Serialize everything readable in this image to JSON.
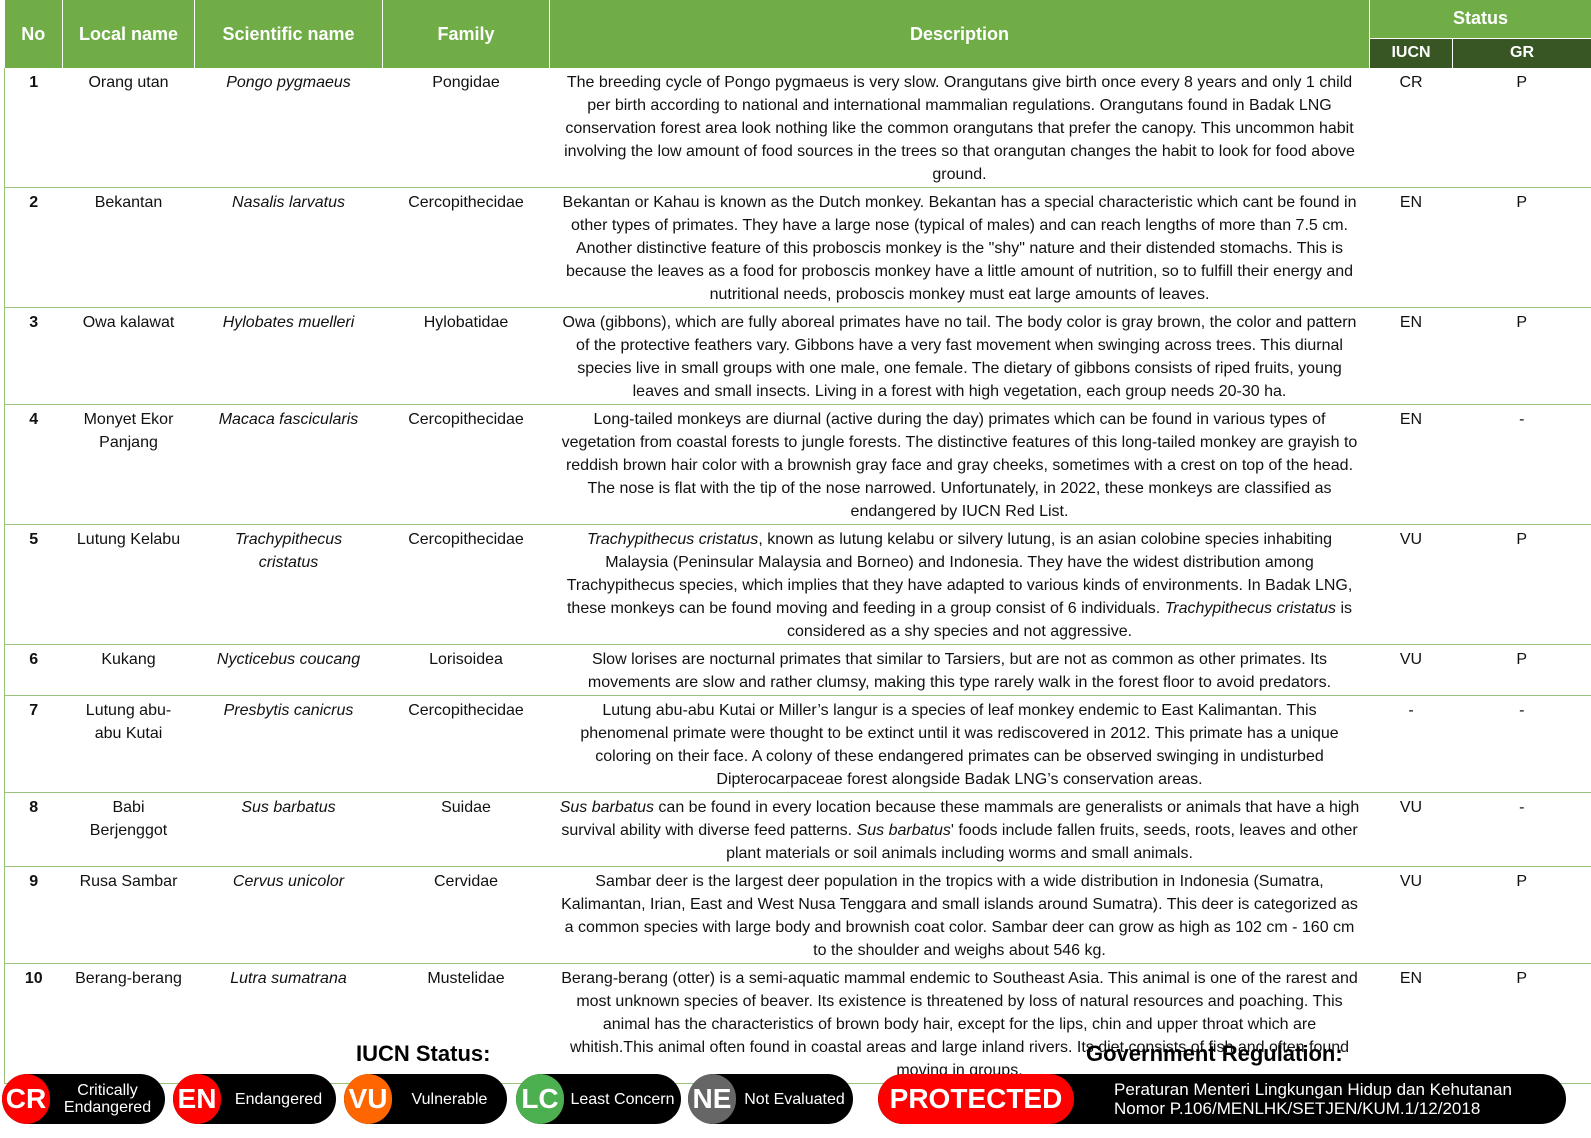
{
  "table": {
    "headers": {
      "no": "No",
      "local": "Local name",
      "scientific": "Scientific name",
      "family": "Family",
      "description": "Description",
      "status": "Status",
      "iucn": "IUCN",
      "gr": "GR"
    },
    "rows": [
      {
        "no": "1",
        "local": "Orang utan",
        "sci": "Pongo pygmaeus",
        "family": "Pongidae",
        "desc": [
          {
            "t": "The breeding cycle of Pongo pygmaeus is very slow. Orangutans give birth once every 8 years and only 1 child per birth according to national and international mammalian regulations. Orangutans found in Badak LNG conservation forest area look nothing like the common orangutans that prefer the canopy. This uncommon habit involving the low amount of food sources in the trees so that orangutan changes the habit to look for food above ground."
          }
        ],
        "iucn": "CR",
        "gr": "P"
      },
      {
        "no": "2",
        "local": "Bekantan",
        "sci": "Nasalis larvatus",
        "family": "Cercopithecidae",
        "desc": [
          {
            "t": "Bekantan or Kahau is known as the Dutch monkey. Bekantan has a special characteristic which cant be found in other types of primates. They have a large nose (typical of males) and can reach lengths of more than 7.5 cm. Another distinctive feature of this proboscis monkey is the \"shy\" nature and their distended stomachs. This is because the leaves as a food for proboscis monkey have a little amount of nutrition, so to fulfill their energy and nutritional needs, proboscis monkey must eat large amounts of leaves."
          }
        ],
        "iucn": "EN",
        "gr": "P"
      },
      {
        "no": "3",
        "local": "Owa kalawat",
        "sci": "Hylobates muelleri",
        "family": "Hylobatidae",
        "desc": [
          {
            "t": "Owa (gibbons), which are fully aboreal primates have no tail. The body color is gray brown, the color and pattern of the protective feathers vary. Gibbons have a very fast movement when swinging across trees. This diurnal species live in small groups with one male, one female. The dietary of gibbons consists of riped fruits, young leaves and small insects. Living in a forest with high vegetation, each group needs 20-30 ha."
          }
        ],
        "iucn": "EN",
        "gr": "P"
      },
      {
        "no": "4",
        "local": "Monyet Ekor Panjang",
        "sci": "Macaca fascicularis",
        "family": "Cercopithecidae",
        "desc": [
          {
            "t": "Long-tailed monkeys are diurnal (active during the day) primates which can be found in various types of vegetation from coastal forests to jungle forests. The distinctive features of this long-tailed monkey are grayish to reddish brown hair color with a brownish gray face and gray cheeks, sometimes with a crest on top of the head. The nose is flat with the tip of the nose narrowed. Unfortunately, in 2022, these monkeys are classified as endangered by IUCN Red List."
          }
        ],
        "iucn": "EN",
        "gr": "-"
      },
      {
        "no": "5",
        "local": "Lutung Kelabu",
        "sci": "Trachypithecus cristatus",
        "family": "Cercopithecidae",
        "desc": [
          {
            "t": "Trachypithecus cristatus",
            "i": true
          },
          {
            "t": ", known as lutung kelabu or silvery lutung, is an asian colobine species inhabiting Malaysia (Peninsular Malaysia and Borneo) and Indonesia. They have the widest distribution among Trachypithecus species, which implies that they have adapted to various kinds of environments. In Badak LNG, these monkeys can be found moving and feeding in a group consist of 6 individuals. "
          },
          {
            "t": "Trachypithecus cristatus",
            "i": true
          },
          {
            "t": " is considered as a shy species and not aggressive."
          }
        ],
        "iucn": "VU",
        "gr": "P"
      },
      {
        "no": "6",
        "local": "Kukang",
        "sci": "Nycticebus coucang",
        "family": "Lorisoidea",
        "desc": [
          {
            "t": "Slow lorises are nocturnal primates that similar to Tarsiers, but are not as common as other primates. Its movements are slow and rather clumsy, making this type rarely walk in the forest floor to avoid predators."
          }
        ],
        "iucn": "VU",
        "gr": "P"
      },
      {
        "no": "7",
        "local": "Lutung abu-abu Kutai",
        "sci": "Presbytis canicrus",
        "family": "Cercopithecidae",
        "desc": [
          {
            "t": "Lutung abu-abu Kutai or Miller’s langur is a species of leaf monkey endemic to East Kalimantan. This phenomenal primate were thought to be extinct until it was rediscovered in 2012. This primate has a unique coloring on their face. A colony of these endangered primates can be observed swinging in undisturbed Dipterocarpaceae forest alongside Badak LNG’s conservation areas."
          }
        ],
        "iucn": "-",
        "gr": "-"
      },
      {
        "no": "8",
        "local": "Babi Berjenggot",
        "sci": "Sus barbatus",
        "family": "Suidae",
        "desc": [
          {
            "t": "Sus barbatus",
            "i": true
          },
          {
            "t": " can be found in every location because these mammals are generalists or animals that have a high survival ability with diverse feed patterns. "
          },
          {
            "t": "Sus barbatus",
            "i": true
          },
          {
            "t": "' foods include fallen fruits, seeds, roots, leaves and other plant materials or soil animals including worms and small animals."
          }
        ],
        "iucn": "VU",
        "gr": "-"
      },
      {
        "no": "9",
        "local": "Rusa Sambar",
        "sci": "Cervus unicolor",
        "family": "Cervidae",
        "desc": [
          {
            "t": "Sambar deer is the largest deer population in the tropics with a wide distribution in Indonesia (Sumatra, Kalimantan, Irian, East and West Nusa Tenggara and small islands around Sumatra). This deer is categorized as a common species with large body and brownish coat color. Sambar deer can grow as high as 102 cm - 160 cm to the shoulder and weighs about 546 kg."
          }
        ],
        "iucn": "VU",
        "gr": "P"
      },
      {
        "no": "10",
        "local": "Berang-berang",
        "sci": "Lutra sumatrana",
        "family": "Mustelidae",
        "desc": [
          {
            "t": "Berang-berang (otter) is a semi-aquatic mammal endemic to Southeast Asia. This animal is one of the rarest and most unknown species of beaver. Its existence is threatened by loss of natural resources and poaching. This animal has the characteristics of brown body hair, except for the lips, chin and upper throat which are whitish.This animal often found in coastal areas and large inland rivers. Its diet consists of fish and often found moving in groups."
          }
        ],
        "iucn": "EN",
        "gr": "P"
      }
    ]
  },
  "legend": {
    "iucn_title": "IUCN Status:",
    "gr_title": "Government Regulation:",
    "items": [
      {
        "code": "CR",
        "label": "Critically Endangered",
        "color": "#ff0000"
      },
      {
        "code": "EN",
        "label": "Endangered",
        "color": "#ff0000"
      },
      {
        "code": "VU",
        "label": "Vulnerable",
        "color": "#ff6600"
      },
      {
        "code": "LC",
        "label": "Least Concern",
        "color": "#4caf50"
      },
      {
        "code": "NE",
        "label": "Not Evaluated",
        "color": "#666666"
      }
    ],
    "protected": {
      "code": "PROTECTED",
      "label": "Peraturan Menteri Lingkungan Hidup dan Kehutanan Nomor P.106/MENLHK/SETJEN/KUM.1/12/2018",
      "color": "#ff0000"
    }
  },
  "colors": {
    "header": "#70ad47",
    "subheader": "#375623",
    "border": "#9bc27a"
  }
}
